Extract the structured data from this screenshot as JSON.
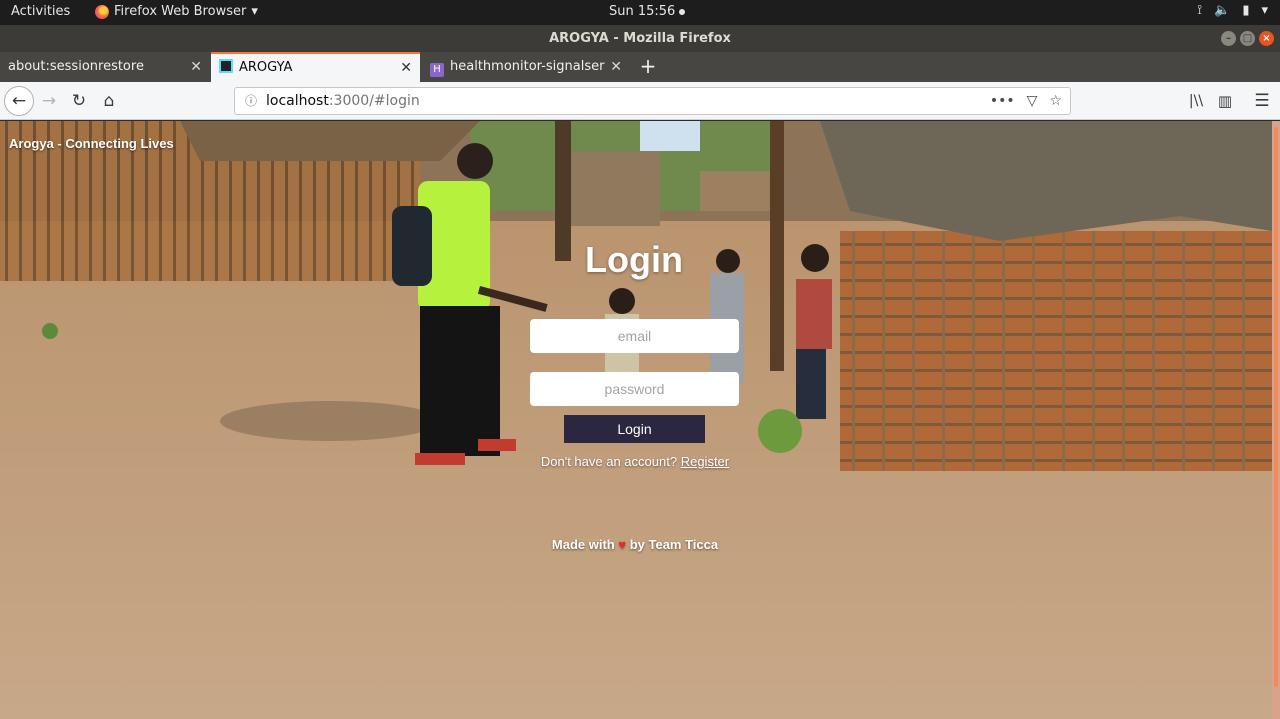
{
  "system": {
    "activities": "Activities",
    "app_name": "Firefox Web Browser",
    "app_arrow": "▾",
    "clock": "Sun 15:56",
    "tray": {
      "wifi": "⟟",
      "volume": "🔈",
      "battery": "▮",
      "menu": "▾"
    }
  },
  "window": {
    "title": "AROGYA - Mozilla Firefox"
  },
  "tabs": [
    {
      "label": "about:sessionrestore",
      "close": "✕"
    },
    {
      "label": "AROGYA",
      "close": "✕"
    },
    {
      "label": "healthmonitor-signalser",
      "close": "✕",
      "favicon": "H"
    }
  ],
  "newtab": "+",
  "nav": {
    "back": "←",
    "forward": "→",
    "reload": "↻",
    "home": "⌂",
    "url_host": "localhost",
    "url_rest": ":3000/#login",
    "info": "ⓘ",
    "more": "•••",
    "pocket": "▽",
    "star": "☆",
    "library": "|\\\\",
    "sidebar": "▥",
    "menu": "☰"
  },
  "page": {
    "brand": "Arogya - Connecting Lives",
    "login_title": "Login",
    "email_placeholder": "email",
    "password_placeholder": "password",
    "login_button": "Login",
    "no_account_text": "Don't have an account?",
    "register_link": "Register",
    "made_with": "Made with",
    "heart": "♥",
    "by_team": "by Team Ticca"
  },
  "colors": {
    "tab_accent": "#ff7139",
    "login_button_bg": "#2c2740",
    "scrollbar": "#f08a5d",
    "heart": "#e8282f"
  }
}
